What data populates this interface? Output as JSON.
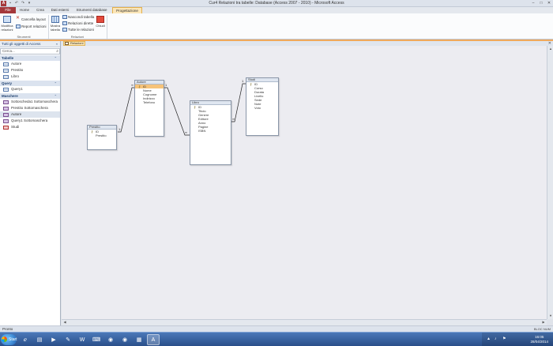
{
  "app": {
    "logo": "A",
    "title": "Cur4 Relazioni tra tabelle: Database (Access 2007 - 2010) - Microsoft Access",
    "window_controls": [
      "–",
      "□",
      "✕"
    ],
    "qat_icons": [
      "save-icon",
      "undo-icon",
      "redo-icon",
      "customize-icon"
    ]
  },
  "ribbon": {
    "tabs": [
      {
        "label": "File",
        "active": false
      },
      {
        "label": "Home",
        "active": false
      },
      {
        "label": "Crea",
        "active": false
      },
      {
        "label": "Dati esterni",
        "active": false
      },
      {
        "label": "Strumenti database",
        "active": false
      },
      {
        "label": "Progettazione",
        "active": true
      }
    ],
    "tools": {
      "modifica_relazioni": "Modifica relazioni",
      "cancella_layout": "Cancella layout",
      "report_relazioni": "Report relazioni",
      "group_strumenti": "Strumenti"
    },
    "relazioni": {
      "mostra_tabella": "Mostra tabella",
      "nascondi_tabella": "Nascondi tabella",
      "relazioni_dirette": "Relazioni dirette",
      "tutte_relazioni": "Tutte le relazioni",
      "chiudi": "Chiudi",
      "group_relazioni": "Relazioni"
    }
  },
  "nav": {
    "header": "Tutti gli oggetti di Access",
    "search_placeholder": "Cerca...",
    "sections": [
      {
        "title": "Tabelle",
        "items": [
          {
            "label": "Autore",
            "icon": "table-icon"
          },
          {
            "label": "Prestito",
            "icon": "table-icon"
          },
          {
            "label": "Libro",
            "icon": "table-icon"
          }
        ]
      },
      {
        "title": "Query",
        "items": [
          {
            "label": "Query1",
            "icon": "query-icon"
          }
        ]
      },
      {
        "title": "Maschere",
        "items": [
          {
            "label": "Sottoscheda1 Sottomaschera",
            "icon": "form-icon"
          },
          {
            "label": "Prestito Sottomaschera",
            "icon": "form-icon"
          },
          {
            "label": "Autore",
            "icon": "form-icon",
            "selected": true
          },
          {
            "label": "Query1 Sottomaschera",
            "icon": "form-icon"
          },
          {
            "label": "Studi",
            "icon": "form-icon-red"
          }
        ]
      }
    ]
  },
  "document": {
    "tab_label": "Relazioni",
    "close_icon": "✕"
  },
  "tables": {
    "prestito": {
      "title": "Prestito",
      "fields": [
        {
          "name": "ID",
          "key": true
        },
        {
          "name": "Prestito",
          "key": false
        }
      ]
    },
    "autore": {
      "title": "Autore",
      "fields": [
        {
          "name": "ID",
          "key": true,
          "selected": true
        },
        {
          "name": "Nome",
          "key": false
        },
        {
          "name": "Cognome",
          "key": false
        },
        {
          "name": "Indirizzo",
          "key": false
        },
        {
          "name": "Telefono",
          "key": false
        }
      ]
    },
    "libro": {
      "title": "Libro",
      "fields": [
        {
          "name": "ID",
          "key": true
        },
        {
          "name": "Titolo",
          "key": false
        },
        {
          "name": "Genere",
          "key": false
        },
        {
          "name": "Editore",
          "key": false
        },
        {
          "name": "Anno",
          "key": false
        },
        {
          "name": "Pagine",
          "key": false
        },
        {
          "name": "ISBN",
          "key": false
        }
      ]
    },
    "studi": {
      "title": "Studi",
      "fields": [
        {
          "name": "ID",
          "key": true
        },
        {
          "name": "Corso",
          "key": false
        },
        {
          "name": "Durata",
          "key": false
        },
        {
          "name": "Livello",
          "key": false
        },
        {
          "name": "Sede",
          "key": false
        },
        {
          "name": "Note",
          "key": false
        },
        {
          "name": "Voto",
          "key": false
        }
      ]
    }
  },
  "relations": {
    "one": "1",
    "many": "∞"
  },
  "status": {
    "text": "Pronto",
    "indicators": "BLOC NUM"
  },
  "taskbar": {
    "start_label": "Start",
    "clock_time": "16:05",
    "clock_date": "28/04/2014",
    "apps": [
      "ie-icon",
      "explorer-icon",
      "media-icon",
      "notepad-icon",
      "word-icon",
      "network-icon",
      "chrome-icon",
      "chrome-icon",
      "folder-icon",
      "access-icon"
    ]
  }
}
